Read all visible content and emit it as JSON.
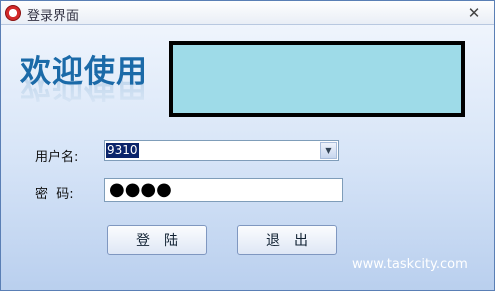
{
  "window": {
    "title": "登录界面",
    "close_symbol": "✕"
  },
  "banner": {
    "text": "欢迎使用"
  },
  "form": {
    "username_label": "用户名:",
    "username_value": "9310",
    "password_label": "密  码:",
    "password_value": "●●●●"
  },
  "buttons": {
    "login_label": "登陆",
    "exit_label": "退出"
  },
  "watermark": "www.taskcity.com",
  "icons": {
    "app": "app-icon",
    "close": "close-icon",
    "dropdown": "chevron-down-icon"
  },
  "colors": {
    "banner_text": "#1b6aa8",
    "redacted_box": "#9edbe8",
    "selection": "#0a246a"
  }
}
